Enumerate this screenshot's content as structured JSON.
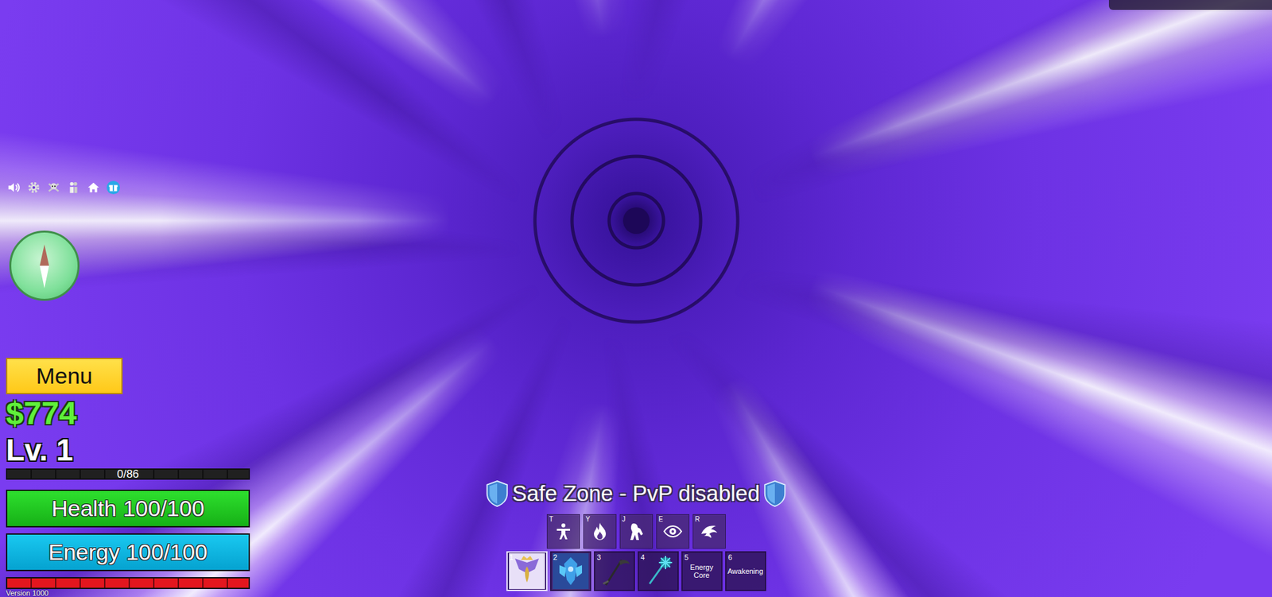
{
  "menu_button": "Menu",
  "money": "$774",
  "level": "Lv. 1",
  "xp": {
    "reading": "0/86",
    "level": 0
  },
  "health": {
    "reading": "Health 100/100",
    "level": 1
  },
  "energy": {
    "reading": "Energy 100/100",
    "level": 1
  },
  "stamina": {
    "level": 1
  },
  "version": "Version 1000",
  "zone_banner": "Safe Zone - PvP disabled",
  "skills": [
    {
      "key": "T"
    },
    {
      "key": "Y"
    },
    {
      "key": "J"
    },
    {
      "key": "E"
    },
    {
      "key": "R"
    }
  ],
  "hotbar": [
    {
      "slot": "1",
      "kind": "icon",
      "selected": true
    },
    {
      "slot": "2",
      "kind": "icon",
      "selected": false
    },
    {
      "slot": "3",
      "kind": "icon",
      "selected": false
    },
    {
      "slot": "4",
      "kind": "icon",
      "selected": false
    },
    {
      "slot": "5",
      "kind": "text",
      "label": "Energy Core",
      "selected": false
    },
    {
      "slot": "6",
      "kind": "text",
      "label": "Awakening",
      "selected": false
    }
  ]
}
